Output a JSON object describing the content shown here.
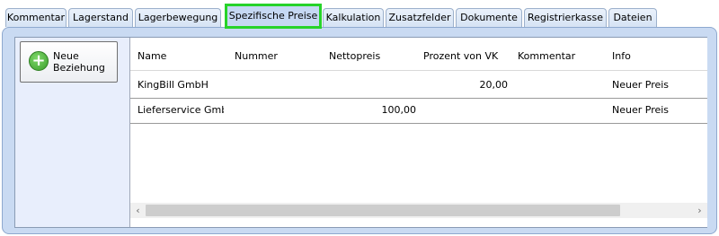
{
  "tabs": [
    {
      "label": "Kommentar"
    },
    {
      "label": "Lagerstand"
    },
    {
      "label": "Lagerbewegung"
    },
    {
      "label": "Spezifische Preise"
    },
    {
      "label": "Kalkulation"
    },
    {
      "label": "Zusatzfelder"
    },
    {
      "label": "Dokumente"
    },
    {
      "label": "Registrierkasse"
    },
    {
      "label": "Dateien"
    }
  ],
  "active_tab": "Spezifische Preise",
  "toolbar": {
    "new_relation_label": "Neue Beziehung",
    "new_relation_icon": "plus-circle-icon"
  },
  "table": {
    "columns": [
      "Name",
      "Nummer",
      "Nettopreis",
      "Prozent von VK",
      "Kommentar",
      "Info"
    ],
    "rows": [
      {
        "name": "KingBill GmbH",
        "nummer": "",
        "nettopreis": "",
        "prozent_von_vk": "20,00",
        "kommentar": "",
        "info": "Neuer Preis"
      },
      {
        "name": "Lieferservice GmbH",
        "nummer": "",
        "nettopreis": "100,00",
        "prozent_von_vk": "",
        "kommentar": "",
        "info": "Neuer Preis"
      }
    ]
  },
  "scrollbar": {
    "left_arrow": "‹",
    "right_arrow": "›"
  },
  "colors": {
    "active_tab_border": "#27d32a",
    "panel_background": "#c9daf2",
    "accent_icon": "#3a9e2c"
  }
}
